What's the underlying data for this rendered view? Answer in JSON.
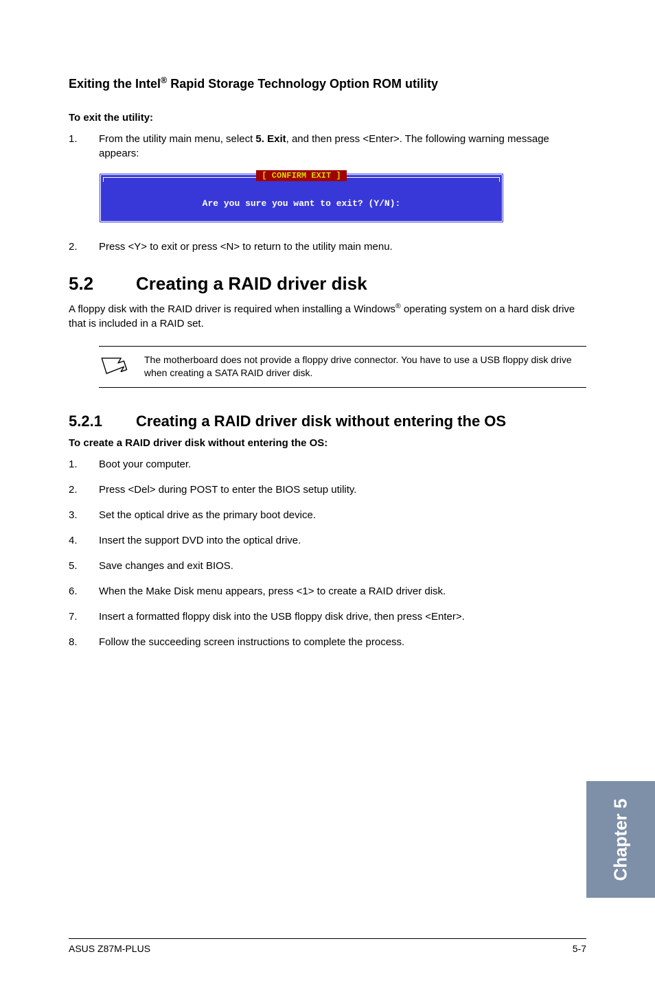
{
  "heading_exit": "Exiting the Intel® Rapid Storage Technology Option ROM utility",
  "exit_label": "To exit the utility:",
  "exit_step1_num": "1.",
  "exit_step1_body_a": "From the utility main menu, select ",
  "exit_step1_body_bold": "5. Exit",
  "exit_step1_body_b": ", and then press <Enter>. The following warning message appears:",
  "confirm_title": "[ CONFIRM EXIT ]",
  "confirm_text": "Are you sure you want to exit? (Y/N):",
  "exit_step2_num": "2.",
  "exit_step2_body": "Press <Y> to exit or press <N> to return to the utility main menu.",
  "sec52_num": "5.2",
  "sec52_title": "Creating a RAID driver disk",
  "sec52_body_a": "A floppy disk with the RAID driver is required when installing a Windows",
  "sec52_body_sup": "®",
  "sec52_body_b": " operating system on a hard disk drive that is included in a RAID set.",
  "note_text": "The motherboard does not provide a floppy drive connector. You have to use a USB floppy disk drive when creating a SATA RAID driver disk.",
  "sec521_num": "5.2.1",
  "sec521_title": "Creating a RAID driver disk without entering the OS",
  "create_label": "To create a RAID driver disk without entering the OS:",
  "steps": [
    {
      "n": "1.",
      "t": "Boot your computer."
    },
    {
      "n": "2.",
      "t": "Press <Del> during POST to enter the BIOS setup utility."
    },
    {
      "n": "3.",
      "t": "Set the optical drive as the primary boot device."
    },
    {
      "n": "4.",
      "t": "Insert the support DVD into the optical drive."
    },
    {
      "n": "5.",
      "t": "Save changes and exit BIOS."
    },
    {
      "n": "6.",
      "t": "When the Make Disk menu appears, press <1> to create a RAID driver disk."
    },
    {
      "n": "7.",
      "t": "Insert a formatted floppy disk into the USB floppy disk drive, then press <Enter>."
    },
    {
      "n": "8.",
      "t": "Follow the succeeding screen instructions to complete the process."
    }
  ],
  "chapter_tab": "Chapter 5",
  "footer_left": "ASUS Z87M-PLUS",
  "footer_right": "5-7"
}
